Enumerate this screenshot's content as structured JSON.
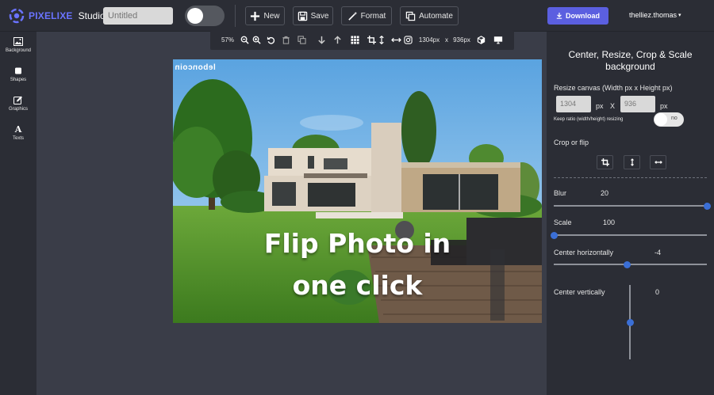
{
  "app": {
    "logo_brand": "PIXELIXE",
    "logo_product": "Studio",
    "design_name_placeholder": "Untitled"
  },
  "toolbar": {
    "new_label": "New",
    "save_label": "Save",
    "format_label": "Format",
    "automate_label": "Automate",
    "download_label": "Download",
    "user_name": "thelliez.thomas"
  },
  "sidebar": {
    "items": [
      {
        "label": "Background",
        "icon": "image-icon"
      },
      {
        "label": "Shapes",
        "icon": "square-icon"
      },
      {
        "label": "Graphics",
        "icon": "edit-icon"
      },
      {
        "label": "Texts",
        "icon": "text-icon"
      }
    ]
  },
  "canvas_toolbar": {
    "zoom": "57%",
    "width_label": "1304px",
    "times_label": "x",
    "height_label": "936px",
    "icons": [
      "zoom-out-icon",
      "zoom-in-icon",
      "undo-icon",
      "delete-icon",
      "duplicate-icon",
      "move-down-icon",
      "move-up-icon",
      "grid-icon",
      "crop-icon",
      "height-icon",
      "width-icon",
      "instagram-icon",
      "3d-icon",
      "preview-icon"
    ]
  },
  "canvas": {
    "watermark": "leboncoin",
    "overlay_line1": "Flip Photo in",
    "overlay_line2": "one click"
  },
  "panel": {
    "title": "Center, Resize, Crop & Scale background",
    "resize_label": "Resize canvas (Width px x Height px)",
    "width_value": "1304",
    "height_value": "936",
    "px_unit": "px",
    "times_sign": "X",
    "keep_ratio_label": "Keep ratio (width/height) resizing",
    "keep_ratio_toggle": "no",
    "crop_flip_label": "Crop or flip",
    "blur_label": "Blur",
    "blur_value": "20",
    "blur_fraction": 1.0,
    "scale_label": "Scale",
    "scale_value": "100",
    "scale_fraction": 0.0,
    "center_h_label": "Center horizontally",
    "center_h_value": "-4",
    "center_h_fraction": 0.48,
    "center_v_label": "Center vertically",
    "center_v_value": "0",
    "center_v_fraction": 0.5
  },
  "colors": {
    "accent": "#5b5fe0",
    "slider_thumb": "#3b6fd6",
    "background": "#3a3d48",
    "panel": "#2b2d35"
  }
}
